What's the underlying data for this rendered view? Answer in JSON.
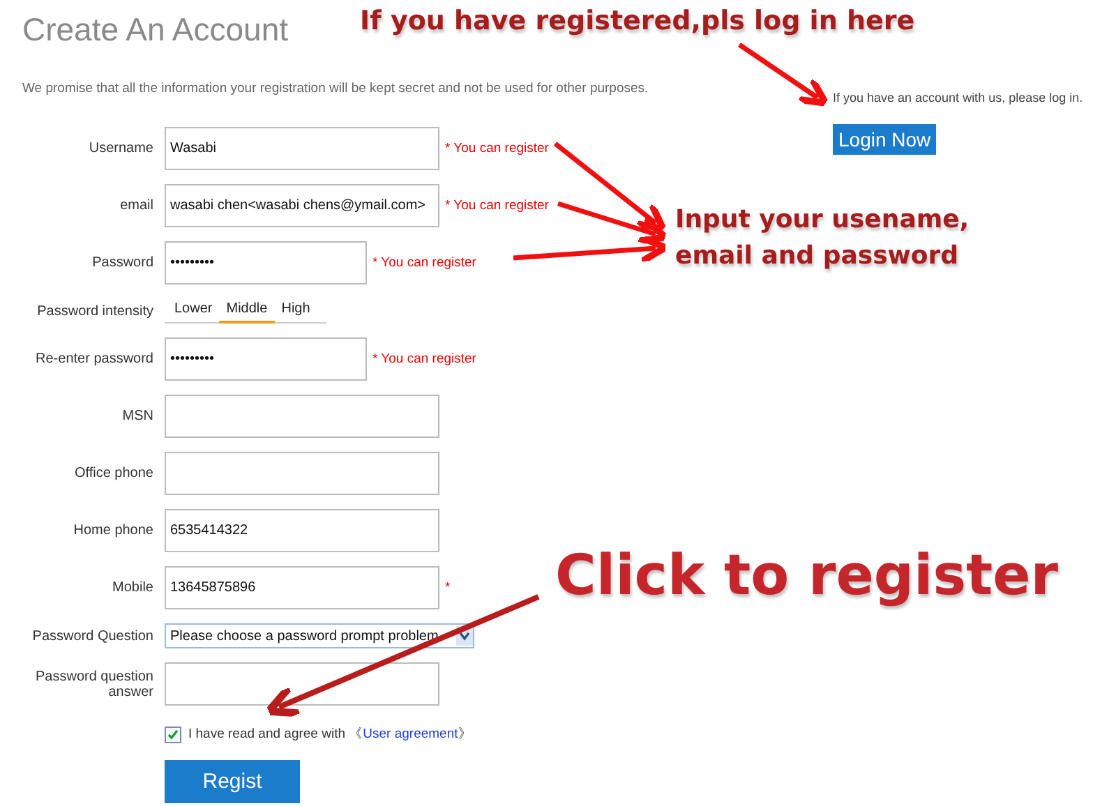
{
  "page": {
    "title": "Create An Account",
    "notice": "We promise that all the information your registration will be kept secret and not be used for other purposes."
  },
  "login": {
    "prompt": "If you have an account with us, please log in.",
    "button": "Login Now"
  },
  "form": {
    "rows": [
      {
        "kind": "text",
        "label": "Username",
        "value": "Wasabi",
        "hint": "* You can register"
      },
      {
        "kind": "text",
        "label": "email",
        "value": "wasabi chen<wasabi chens@ymail.com>",
        "hint": "* You can register"
      },
      {
        "kind": "password",
        "label": "Password",
        "value": "•••••••••",
        "hint": "* You can register"
      },
      {
        "kind": "strength",
        "label": "Password intensity",
        "options": [
          {
            "label": "Lower",
            "selected": false
          },
          {
            "label": "Middle",
            "selected": true
          },
          {
            "label": "High",
            "selected": false
          }
        ]
      },
      {
        "kind": "password",
        "label": "Re-enter password",
        "value": "•••••••••",
        "hint": "* You can register"
      },
      {
        "kind": "text",
        "label": "MSN"
      },
      {
        "kind": "text",
        "label": "Office phone"
      },
      {
        "kind": "text",
        "label": "Home phone",
        "value": "6535414322"
      },
      {
        "kind": "text",
        "label": "Mobile",
        "value": "13645875896",
        "hint": "*"
      },
      {
        "kind": "select",
        "label": "Password Question",
        "value": "Please choose a password prompt problem"
      },
      {
        "kind": "text",
        "label": "Password question answer"
      }
    ],
    "agreement": {
      "checked": true,
      "text": "I have read and agree with 《",
      "link": "User agreement",
      "close": "》"
    },
    "submit": "Regist"
  },
  "annotations": [
    {
      "kind": "login",
      "text": "If you have registered,pls log in here"
    },
    {
      "kind": "input",
      "lines": [
        "Input your usename,",
        "email  and password"
      ]
    },
    {
      "kind": "register",
      "text": "Click to register"
    }
  ]
}
